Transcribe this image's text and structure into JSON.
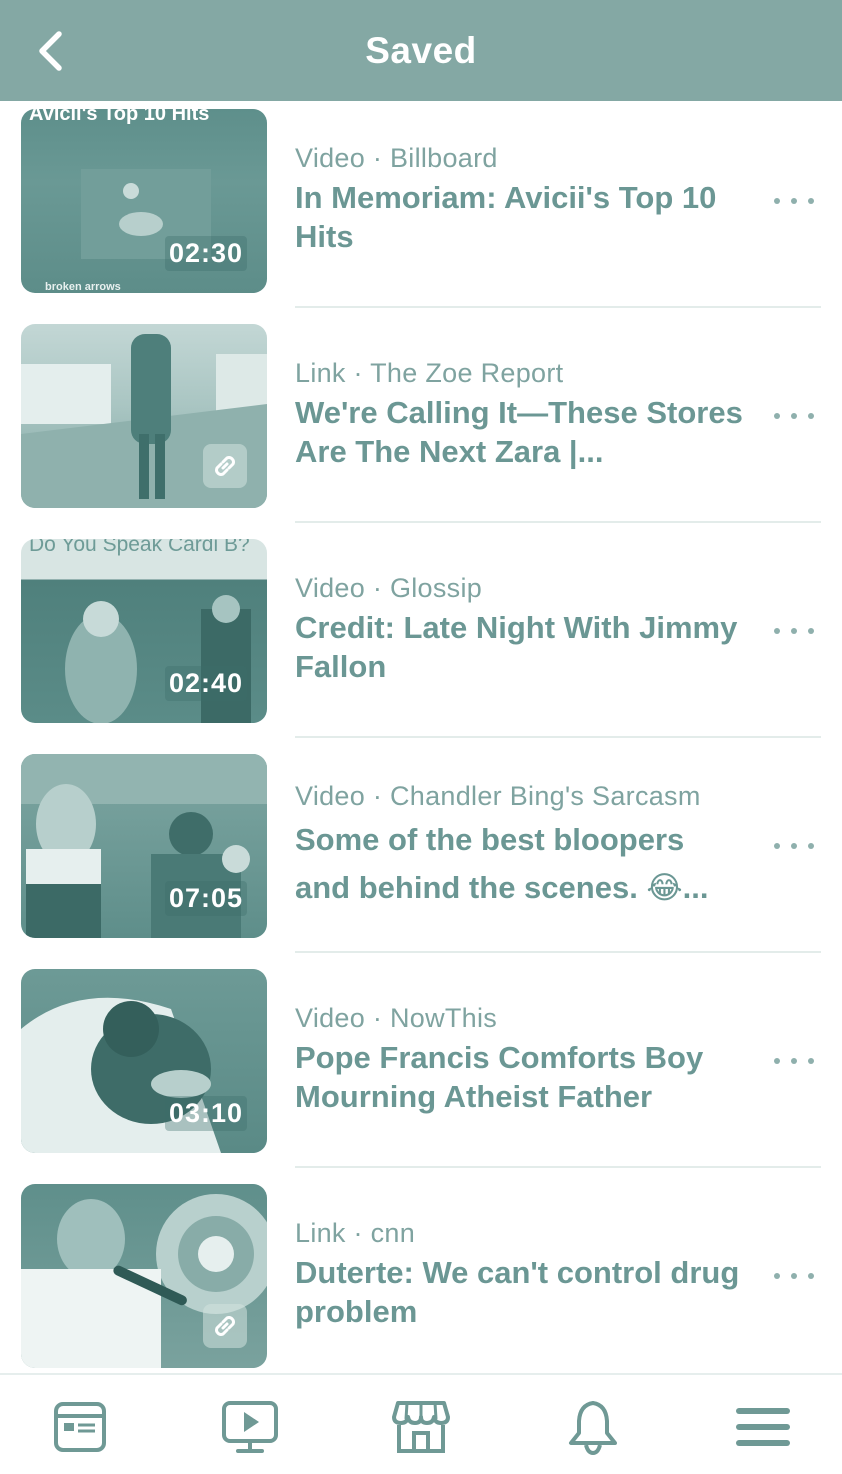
{
  "header": {
    "title": "Saved",
    "back_icon": "chevron-left-icon"
  },
  "items": [
    {
      "type": "Video",
      "source": "Billboard",
      "meta": "Video · Billboard",
      "title": "In Memoriam: Avicii's Top 10 Hits",
      "duration": "02:30",
      "thumb_caption": "Avicii's Top 10 Hits",
      "thumb_subcaption": "broken arrows"
    },
    {
      "type": "Link",
      "source": "The Zoe Report",
      "meta": "Link · The Zoe Report",
      "title": "We're Calling It—These Stores Are The Next Zara |...",
      "badge_icon": "link-icon"
    },
    {
      "type": "Video",
      "source": "Glossip",
      "meta": "Video · Glossip",
      "title": "Credit: Late Night With Jimmy Fallon",
      "duration": "02:40",
      "thumb_caption": "Do You Speak Cardi B?"
    },
    {
      "type": "Video",
      "source": "Chandler Bing's Sarcasm",
      "meta": "Video · Chandler Bing's Sarcasm",
      "title": "Some of the best bloopers and behind the scenes. 😂...",
      "duration": "07:05"
    },
    {
      "type": "Video",
      "source": "NowThis",
      "meta": "Video · NowThis",
      "title": "Pope Francis Comforts Boy Mourning Atheist Father",
      "duration": "03:10"
    },
    {
      "type": "Link",
      "source": "cnn",
      "meta": "Link · cnn",
      "title": "Duterte: We can't control drug problem",
      "badge_icon": "link-icon"
    }
  ],
  "more_icon": "more-horizontal-icon",
  "tabbar": [
    {
      "name": "news-feed",
      "icon": "news-feed-icon"
    },
    {
      "name": "watch",
      "icon": "video-play-icon"
    },
    {
      "name": "marketplace",
      "icon": "storefront-icon"
    },
    {
      "name": "notifications",
      "icon": "bell-icon"
    },
    {
      "name": "menu",
      "icon": "hamburger-menu-icon"
    }
  ],
  "colors": {
    "header": "#84a8a4",
    "accent_text": "#6b9794",
    "meta_text": "#7fa3a0",
    "tab_icon": "#6f9995"
  }
}
